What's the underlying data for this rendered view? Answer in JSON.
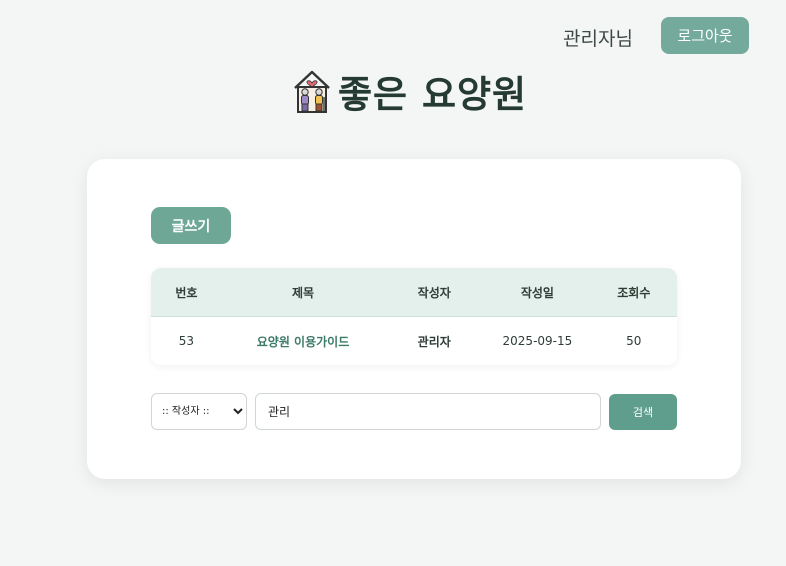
{
  "header": {
    "user_name": "관리자님",
    "logout_label": "로그아웃"
  },
  "site": {
    "title": "좋은 요양원",
    "logo_icon": "elderly-couple-house-icon"
  },
  "board": {
    "write_label": "글쓰기",
    "columns": [
      "번호",
      "제목",
      "작성자",
      "작성일",
      "조회수"
    ],
    "rows": [
      {
        "no": "53",
        "title": "요양원 이용가이드",
        "writer": "관리자",
        "date": "2025-09-15",
        "views": "50"
      }
    ]
  },
  "search": {
    "select_value": ":: 작성자 ::",
    "query": "관리",
    "button_label": "검색"
  },
  "colors": {
    "accent": "#74aa9c",
    "title_text": "#243a33",
    "header_row": "#e4f0ec",
    "link_text": "#3c7a68"
  }
}
